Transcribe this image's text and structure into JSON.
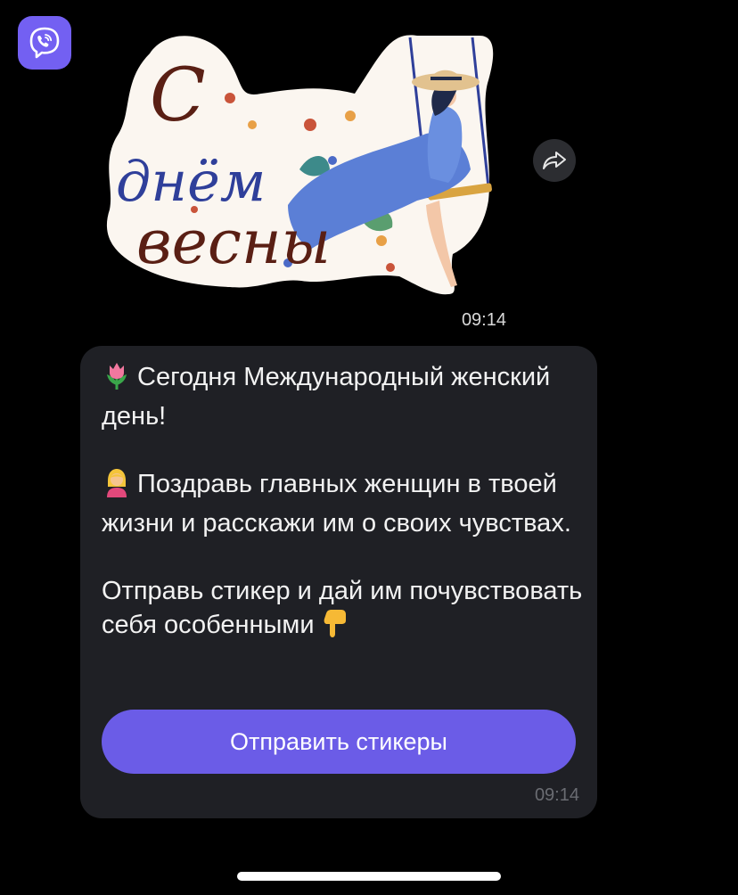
{
  "sender": {
    "avatar_icon": "viber-icon",
    "brand_color": "#7360f2"
  },
  "sticker": {
    "line1": "С",
    "line2": "днём",
    "line3": "весны",
    "time": "09:14"
  },
  "forward": {
    "icon": "forward-icon"
  },
  "message": {
    "paragraph1_emoji": "tulip-icon",
    "paragraph1": "Сегодня Международный женский день!",
    "paragraph2_emoji": "person-tipping-hand-icon",
    "paragraph2": "Поздравь главных женщин в твоей жизни и расскажи им о своих чувствах.",
    "paragraph3": "Отправь стикер и дай им почувствовать себя особенными",
    "paragraph3_emoji": "pointing-down-icon",
    "button_label": "Отправить стикеры",
    "button_color": "#6b5ce7",
    "time": "09:14"
  }
}
